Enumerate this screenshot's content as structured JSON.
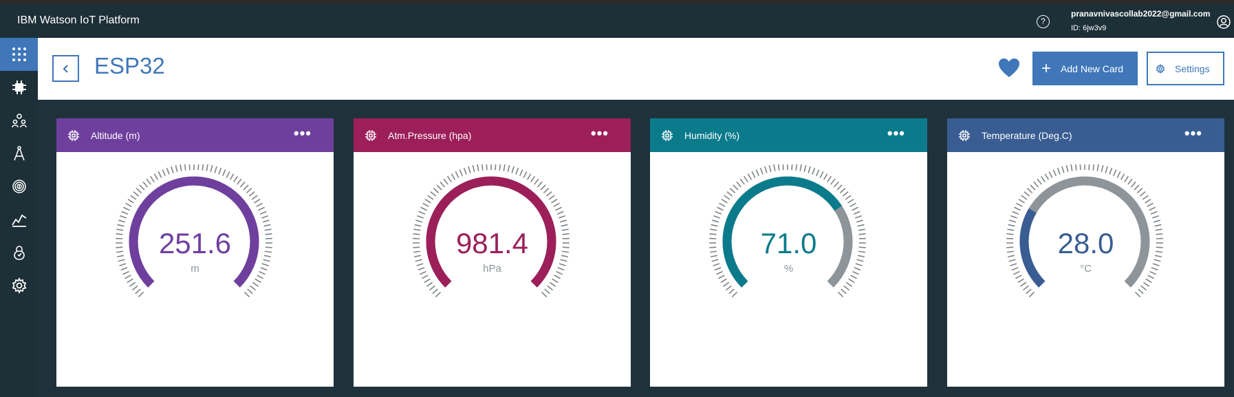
{
  "app": {
    "title": "IBM Watson IoT Platform",
    "help_glyph": "?",
    "user_email": "pranavnivascollab2022@gmail.com",
    "user_id": "ID: 6jw3v9"
  },
  "sidebar": {
    "items": [
      {
        "name": "apps-grid-icon",
        "active": true
      },
      {
        "name": "devices-chip-icon",
        "active": false
      },
      {
        "name": "members-icon",
        "active": false
      },
      {
        "name": "apps-compass-icon",
        "active": false
      },
      {
        "name": "fingerprint-icon",
        "active": false
      },
      {
        "name": "analytics-icon",
        "active": false
      },
      {
        "name": "security-lock-icon",
        "active": false
      },
      {
        "name": "settings-gear-icon",
        "active": false
      }
    ]
  },
  "header": {
    "title": "ESP32",
    "add_card_label": "Add New Card",
    "settings_label": "Settings"
  },
  "colors": {
    "accent": "#3f77b9",
    "track": "#8d959a",
    "altitude": "#6f3f9e",
    "pressure": "#9c1f5a",
    "humidity": "#0b7b8c",
    "temperature": "#395d92"
  },
  "cards": [
    {
      "title": "Altitude (m)",
      "value": "251.6",
      "unit": "m",
      "color": "#6f3f9e",
      "fraction": 1.0
    },
    {
      "title": "Atm.Pressure (hpa)",
      "value": "981.4",
      "unit": "hPa",
      "color": "#9c1f5a",
      "fraction": 1.0
    },
    {
      "title": "Humidity (%)",
      "value": "71.0",
      "unit": "%",
      "color": "#0b7b8c",
      "fraction": 0.71
    },
    {
      "title": "Temperature (Deg.C)",
      "value": "28.0",
      "unit": "°C",
      "color": "#395d92",
      "fraction": 0.28
    }
  ]
}
